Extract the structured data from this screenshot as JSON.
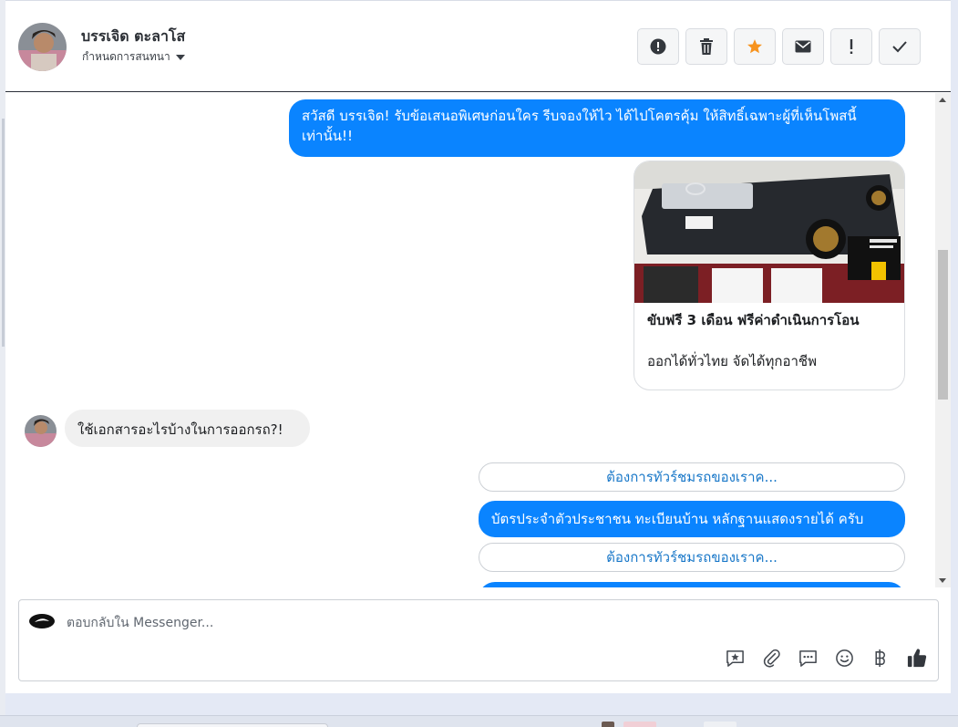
{
  "header": {
    "contact_name": "บรรเจิด ตะลาโส",
    "assign_label": "กำหนดการสนทนา",
    "actions": [
      {
        "icon": "alert-circle-icon",
        "name": "report-button"
      },
      {
        "icon": "trash-icon",
        "name": "delete-button"
      },
      {
        "icon": "star-icon",
        "name": "star-button"
      },
      {
        "icon": "envelope-icon",
        "name": "mark-unread-button"
      },
      {
        "icon": "exclamation-icon",
        "name": "spam-button"
      },
      {
        "icon": "check-icon",
        "name": "done-button"
      }
    ],
    "star_color": "#f7931e"
  },
  "messages": {
    "greeting": "สวัสดี บรรเจิด! รับข้อเสนอพิเศษก่อนใคร รีบจองให้ไว ได้ไปโคตรคุ้ม ให้สิทธิ์เฉพาะผู้ที่เห็นโพสนี้เท่านั้น!!",
    "card_title": "ขับฟรี 3 เดือน ฟรีค่าดำเนินการโอน",
    "card_subtitle": "ออกได้ทั่วไทย จัดได้ทุกอาชีพ",
    "incoming": "ใช้เอกสารอะไรบ้างในการออกรถ?!",
    "quick_reply": "ต้องการทัวร์ชมรถของเราค...",
    "answer": "บัตรประจำตัวประชาชน ทะเบียนบ้าน หลักฐานแสดงรายได้ ครับ",
    "quick_reply_2": "ต้องการทัวร์ชมรถของเราค..."
  },
  "composer": {
    "placeholder": "ตอบกลับใน Messenger...",
    "tools": [
      "saved-reply-icon",
      "attachment-icon",
      "chat-bubble-icon",
      "emoji-icon",
      "baht-icon",
      "like-icon"
    ]
  },
  "colors": {
    "accent": "#0a84ff",
    "link": "#1877c8"
  }
}
